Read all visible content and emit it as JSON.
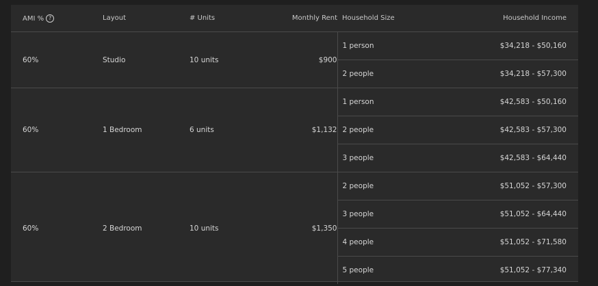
{
  "headers": {
    "ami": "AMI %",
    "help_icon": "?",
    "layout": "Layout",
    "units": "# Units",
    "rent": "Monthly Rent",
    "size": "Household Size",
    "income": "Household Income"
  },
  "groups": [
    {
      "ami": "60%",
      "layout": "Studio",
      "units": "10 units",
      "rent": "$900",
      "rows": [
        {
          "size": "1 person",
          "income": "$34,218 - $50,160"
        },
        {
          "size": "2 people",
          "income": "$34,218 - $57,300"
        }
      ]
    },
    {
      "ami": "60%",
      "layout": "1 Bedroom",
      "units": "6 units",
      "rent": "$1,132",
      "rows": [
        {
          "size": "1 person",
          "income": "$42,583 - $50,160"
        },
        {
          "size": "2 people",
          "income": "$42,583 - $57,300"
        },
        {
          "size": "3 people",
          "income": "$42,583 - $64,440"
        }
      ]
    },
    {
      "ami": "60%",
      "layout": "2 Bedroom",
      "units": "10 units",
      "rent": "$1,350",
      "rows": [
        {
          "size": "2 people",
          "income": "$51,052 - $57,300"
        },
        {
          "size": "3 people",
          "income": "$51,052 - $64,440"
        },
        {
          "size": "4 people",
          "income": "$51,052 - $71,580"
        },
        {
          "size": "5 people",
          "income": "$51,052 - $77,340"
        }
      ]
    }
  ]
}
